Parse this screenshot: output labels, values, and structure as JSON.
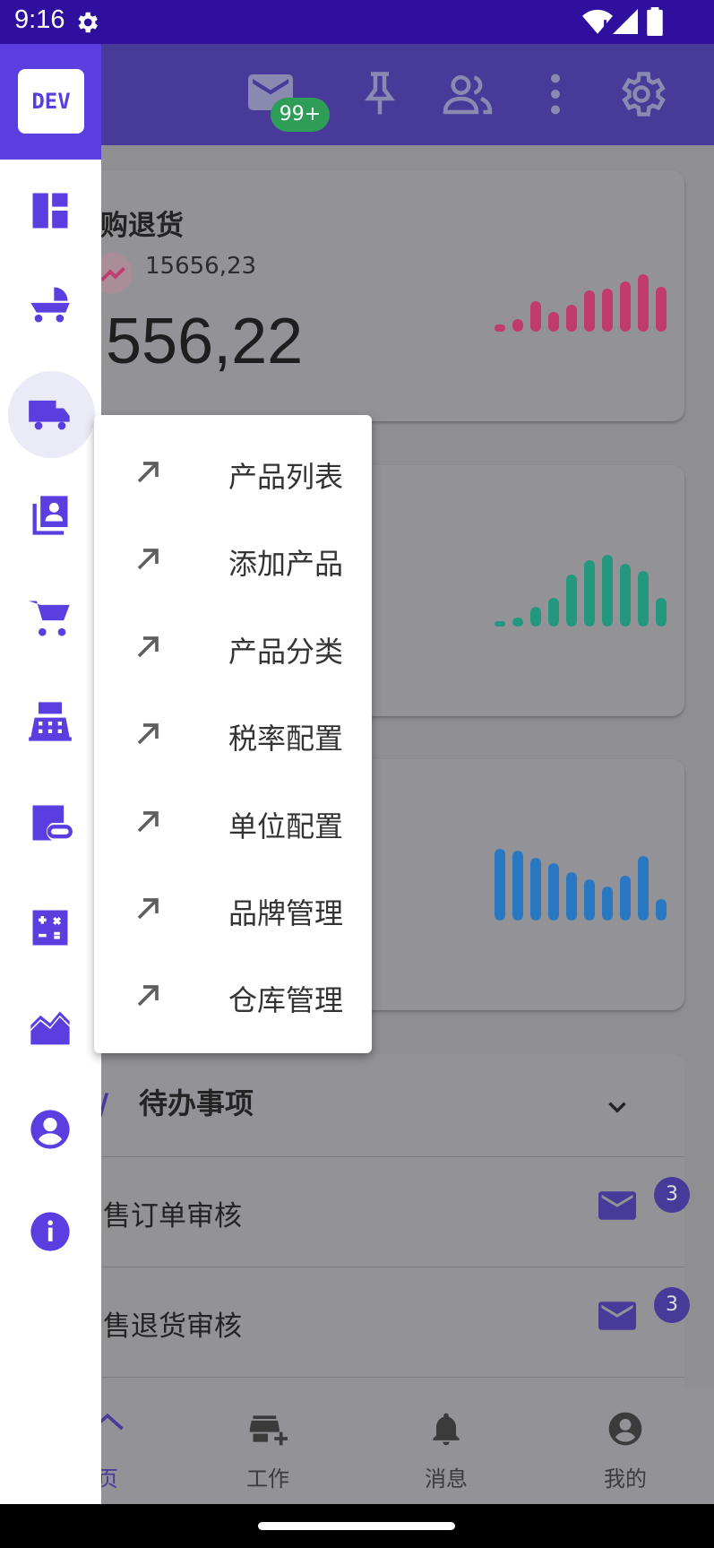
{
  "status": {
    "time": "9:16"
  },
  "topbar": {
    "mail_badge": "99+"
  },
  "cards": [
    {
      "title": "购退货",
      "sub_value": "15656,23",
      "big_value": "556,22",
      "color": "#c23b6f",
      "bars": [
        0.1,
        0.17,
        0.43,
        0.27,
        0.37,
        0.57,
        0.6,
        0.7,
        0.8,
        0.63
      ]
    },
    {
      "color": "#24987f",
      "bars": [
        0.08,
        0.13,
        0.27,
        0.4,
        0.73,
        0.93,
        1.0,
        0.87,
        0.77,
        0.4
      ]
    },
    {
      "color": "#2a78c2",
      "bars": [
        1.0,
        0.97,
        0.87,
        0.8,
        0.67,
        0.57,
        0.47,
        0.63,
        0.9,
        0.3
      ]
    }
  ],
  "todo": {
    "title": "待办事项",
    "rows": [
      {
        "label": "售订单审核",
        "count": "3"
      },
      {
        "label": "售退货审核",
        "count": "3"
      }
    ]
  },
  "bottom_nav": [
    {
      "label": "页"
    },
    {
      "label": "工作"
    },
    {
      "label": "消息"
    },
    {
      "label": "我的"
    }
  ],
  "rail": {
    "logo": "DEV"
  },
  "menu": {
    "items": [
      {
        "label": "产品列表"
      },
      {
        "label": "添加产品"
      },
      {
        "label": "产品分类"
      },
      {
        "label": "税率配置"
      },
      {
        "label": "单位配置"
      },
      {
        "label": "品牌管理"
      },
      {
        "label": "仓库管理"
      }
    ]
  }
}
